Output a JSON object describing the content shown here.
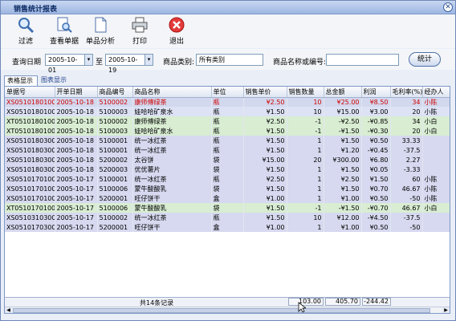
{
  "window": {
    "title": "销售统计报表",
    "close_glyph": "✕"
  },
  "toolbar": {
    "items": [
      {
        "label": "过滤",
        "icon": "magnifier-icon"
      },
      {
        "label": "查看单据",
        "icon": "document-search-icon"
      },
      {
        "label": "单品分析",
        "icon": "document-icon"
      },
      {
        "label": "打印",
        "icon": "printer-icon"
      },
      {
        "label": "退出",
        "icon": "exit-icon"
      }
    ]
  },
  "filter": {
    "query_date_label": "查询日期",
    "date_from": "2005-10-01",
    "to_label": "至",
    "date_to": "2005-10-19",
    "category_label": "商品类别:",
    "category_value": "所有类别",
    "name_code_label": "商品名称或编号:",
    "name_code_value": "",
    "stat_button": "统计"
  },
  "tabs": {
    "table_view": "表格显示",
    "chart_view": "图表显示"
  },
  "grid": {
    "columns": [
      "单据号",
      "开单日期",
      "商品编号",
      "商品名称",
      "单位",
      "销售单价",
      "销售数量",
      "总金额",
      "利润",
      "毛利率(%)",
      "经办人"
    ],
    "rows": [
      [
        "XS051018010001",
        "2005-10-18",
        "5100002",
        "康师傅绿茶",
        "瓶",
        "¥2.50",
        "10",
        "¥25.00",
        "¥8.50",
        "34",
        "小陈"
      ],
      [
        "XS051018010001",
        "2005-10-18",
        "5100003",
        "娃哈哈矿泉水",
        "瓶",
        "¥1.50",
        "10",
        "¥15.00",
        "¥3.00",
        "20",
        "小陈"
      ],
      [
        "XT051018010001",
        "2005-10-18",
        "5100002",
        "康师傅绿茶",
        "瓶",
        "¥2.50",
        "-1",
        "-¥2.50",
        "-¥0.85",
        "34",
        "小白"
      ],
      [
        "XT051018010001",
        "2005-10-18",
        "5100003",
        "娃哈哈矿泉水",
        "瓶",
        "¥1.50",
        "-1",
        "-¥1.50",
        "-¥0.30",
        "20",
        "小白"
      ],
      [
        "XS051018030001",
        "2005-10-18",
        "5100001",
        "统一冰红茶",
        "瓶",
        "¥1.50",
        "1",
        "¥1.50",
        "¥0.50",
        "33.33",
        ""
      ],
      [
        "XS051018030002",
        "2005-10-18",
        "5100001",
        "统一冰红茶",
        "瓶",
        "¥1.50",
        "1",
        "¥1.20",
        "-¥0.45",
        "-37.5",
        ""
      ],
      [
        "XS051018030003",
        "2005-10-18",
        "5200002",
        "太谷饼",
        "袋",
        "¥15.00",
        "20",
        "¥300.00",
        "¥6.80",
        "2.27",
        ""
      ],
      [
        "XS051018030004",
        "2005-10-18",
        "5200003",
        "优优薯片",
        "袋",
        "¥1.50",
        "1",
        "¥1.50",
        "¥0.05",
        "-3.33",
        ""
      ],
      [
        "XS051017010001",
        "2005-10-17",
        "5100001",
        "统一冰红茶",
        "瓶",
        "¥2.50",
        "1",
        "¥2.50",
        "¥1.50",
        "60",
        "小陈"
      ],
      [
        "XS051017010001",
        "2005-10-17",
        "5100006",
        "蒙牛酸酸乳",
        "袋",
        "¥1.50",
        "1",
        "¥1.50",
        "¥0.70",
        "46.67",
        "小陈"
      ],
      [
        "XS051017010001",
        "2005-10-17",
        "5200001",
        "旺仔饼干",
        "盒",
        "¥1.00",
        "1",
        "¥1.00",
        "¥0.50",
        "-50",
        "小陈"
      ],
      [
        "XT051017010001",
        "2005-10-17",
        "5100006",
        "蒙牛酸酸乳",
        "袋",
        "¥1.50",
        "-1",
        "-¥1.50",
        "-¥0.70",
        "46.67",
        "小白"
      ],
      [
        "XS051031030001",
        "2005-10-17",
        "5100002",
        "统一冰红茶",
        "瓶",
        "¥1.50",
        "10",
        "¥12.00",
        "-¥4.50",
        "-37.5",
        ""
      ],
      [
        "XS051017030001",
        "2005-10-17",
        "5200001",
        "旺仔饼干",
        "盒",
        "¥1.00",
        "1",
        "¥1.00",
        "¥0.50",
        "-50",
        ""
      ]
    ],
    "row_styles": [
      "selected",
      "row-blue",
      "row-green",
      "row-green",
      "row-lav",
      "row-lav",
      "row-lav",
      "row-lav",
      "row-lav",
      "row-lav",
      "row-lav",
      "row-green",
      "row-lav",
      "row-lav"
    ]
  },
  "footer": {
    "record_count": "共14条记录",
    "qty_total": "103.00",
    "amount_total": "405.70",
    "profit_total": "-244.42"
  },
  "colors": {
    "accent": "#6f88b8",
    "selected_text": "#d00000",
    "highlight_green": "#d8edd2"
  }
}
